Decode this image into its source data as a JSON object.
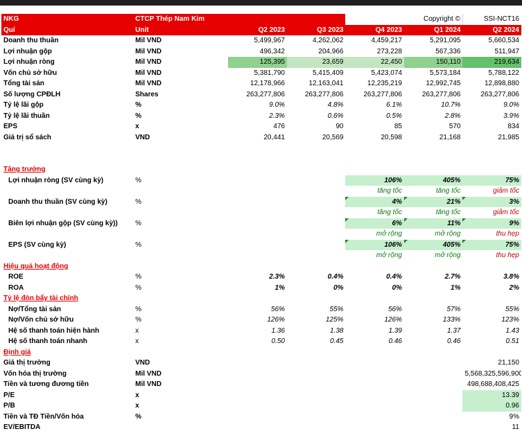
{
  "header": {
    "company_code": "NKG",
    "company_name": "CTCP Thép Nam Kim",
    "copyright": "Copyright ©",
    "report_id": "SSI-NCT16"
  },
  "columns": {
    "label": "Quí",
    "unit": "Unit",
    "periods": [
      "Q2 2023",
      "Q3 2023",
      "Q4 2023",
      "Q1 2024",
      "Q2 2024"
    ]
  },
  "main_rows": [
    {
      "label": "Doanh thu thuần",
      "unit": "Mil VND",
      "values": [
        "5,499,967",
        "4,262,062",
        "4,459,217",
        "5,291,095",
        "5,660,534"
      ]
    },
    {
      "label": "Lợi nhuận gộp",
      "unit": "Mil VND",
      "values": [
        "496,342",
        "204,966",
        "273,228",
        "567,336",
        "511,947"
      ]
    },
    {
      "label": "Lợi nhuận ròng",
      "unit": "Mil VND",
      "values": [
        "125,395",
        "23,659",
        "22,450",
        "150,110",
        "219,634"
      ]
    },
    {
      "label": "Vốn chủ sở hữu",
      "unit": "Mil VND",
      "values": [
        "5,381,790",
        "5,415,409",
        "5,423,074",
        "5,573,184",
        "5,788,122"
      ]
    },
    {
      "label": "Tổng tài sản",
      "unit": "Mil VND",
      "values": [
        "12,178,966",
        "12,163,041",
        "12,235,219",
        "12,992,745",
        "12,898,880"
      ]
    },
    {
      "label": "Số lượng CPĐLH",
      "unit": "Shares",
      "values": [
        "263,277,806",
        "263,277,806",
        "263,277,806",
        "263,277,806",
        "263,277,806"
      ]
    },
    {
      "label": "Tỷ lệ lãi gộp",
      "unit": "%",
      "values": [
        "9.0%",
        "4.8%",
        "6.1%",
        "10.7%",
        "9.0%"
      ]
    },
    {
      "label": "Tỷ lệ lãi thuần",
      "unit": "%",
      "values": [
        "2.3%",
        "0.6%",
        "0.5%",
        "2.8%",
        "3.9%"
      ]
    },
    {
      "label": "EPS",
      "unit": "x",
      "values": [
        "476",
        "90",
        "85",
        "570",
        "834"
      ]
    },
    {
      "label": "Giá trị sổ sách",
      "unit": "VND",
      "values": [
        "20,441",
        "20,569",
        "20,598",
        "21,168",
        "21,985"
      ]
    }
  ],
  "growth": {
    "title": "Tăng trưởng",
    "rows": [
      {
        "label": "Lợi nhuận ròng (SV cùng kỳ)",
        "unit": "%",
        "values": [
          "106%",
          "405%",
          "75%"
        ],
        "notes": [
          "tăng tốc",
          "tăng tốc",
          "giảm tốc"
        ]
      },
      {
        "label": "Doanh thu thuần (SV cùng kỳ)",
        "unit": "%",
        "values": [
          "4%",
          "21%",
          "3%"
        ],
        "notes": [
          "tăng tốc",
          "tăng tốc",
          "giảm tốc"
        ]
      },
      {
        "label": "Biên lợi nhuận gộp (SV cùng kỳ))",
        "unit": "%",
        "values": [
          "6%",
          "11%",
          "9%"
        ],
        "notes": [
          "mở rộng",
          "mở rộng",
          "thu hẹp"
        ]
      },
      {
        "label": "EPS (SV cùng kỳ)",
        "unit": "%",
        "values": [
          "106%",
          "405%",
          "75%"
        ],
        "notes": [
          "mở rộng",
          "mở rộng",
          "thu hẹp"
        ]
      }
    ]
  },
  "efficiency": {
    "title": "Hiệu quả hoạt động",
    "rows": [
      {
        "label": "ROE",
        "unit": "%",
        "values": [
          "2.3%",
          "0.4%",
          "0.4%",
          "2.7%",
          "3.8%"
        ]
      },
      {
        "label": "ROA",
        "unit": "%",
        "values": [
          "1%",
          "0%",
          "0%",
          "1%",
          "2%"
        ]
      }
    ]
  },
  "leverage": {
    "title": "Tỷ lệ đòn bẩy tài chính",
    "rows": [
      {
        "label": "Nợ/Tổng tài sản",
        "unit": "%",
        "values": [
          "56%",
          "55%",
          "56%",
          "57%",
          "55%"
        ]
      },
      {
        "label": "Nợ/Vốn chủ sở hữu",
        "unit": "%",
        "values": [
          "126%",
          "125%",
          "126%",
          "133%",
          "123%"
        ]
      },
      {
        "label": "Hệ số thanh toán hiện hành",
        "unit": "x",
        "values": [
          "1.36",
          "1.38",
          "1.39",
          "1.37",
          "1.43"
        ]
      },
      {
        "label": "Hệ số thanh toán nhanh",
        "unit": "x",
        "values": [
          "0.50",
          "0.45",
          "0.46",
          "0.46",
          "0.51"
        ]
      }
    ]
  },
  "valuation": {
    "title": "Định giá",
    "rows": [
      {
        "label": "Giá thị trường",
        "unit": "VND",
        "value": "21,150"
      },
      {
        "label": "Vốn hóa thị trường",
        "unit": "Mil VND",
        "value": "5,568,325,596,900"
      },
      {
        "label": "Tiền và tương đương tiền",
        "unit": "Mil VND",
        "value": "498,688,408,425"
      },
      {
        "label": "P/E",
        "unit": "x",
        "value": "13.39"
      },
      {
        "label": "P/B",
        "unit": "x",
        "value": "0.96"
      },
      {
        "label": "Tiền và TĐ Tiền/Vốn hóa",
        "unit": "%",
        "value": "9%"
      },
      {
        "label": "EV/EBITDA",
        "unit": "",
        "value": "11"
      }
    ]
  },
  "colors": {
    "header_red": "#e60000",
    "positive_green": "#c6efce",
    "accel_text": "#0a7a0a",
    "decel_text": "#c00000"
  }
}
